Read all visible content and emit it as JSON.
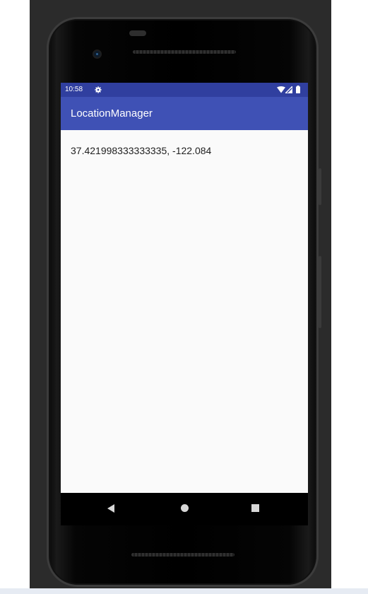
{
  "status_bar": {
    "time": "10:58",
    "icons": [
      "gear-icon",
      "wifi-icon",
      "signal-icon",
      "battery-icon"
    ],
    "color": "#303f9f"
  },
  "app_bar": {
    "title": "LocationManager",
    "color": "#3f51b5"
  },
  "content": {
    "location_text": "37.421998333333335, -122.084"
  },
  "nav_bar": {
    "buttons": [
      "back-icon",
      "home-icon",
      "recents-icon"
    ]
  }
}
